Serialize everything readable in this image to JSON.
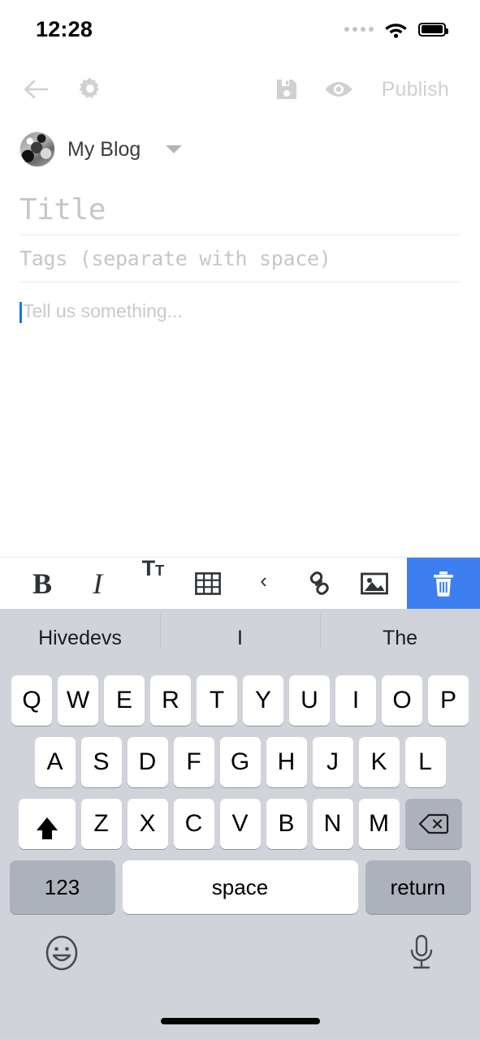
{
  "status_bar": {
    "time": "12:28",
    "signal_icon": "signal-dots-icon",
    "wifi_icon": "wifi-icon",
    "battery_icon": "battery-full-icon"
  },
  "top_toolbar": {
    "back_icon": "back-arrow-icon",
    "settings_icon": "gear-icon",
    "save_icon": "save-disk-icon",
    "preview_icon": "eye-icon",
    "publish_label": "Publish",
    "disabled_color": "#cfd0d2"
  },
  "blog_selector": {
    "avatar_icon": "avatar",
    "name": "My Blog",
    "dropdown_icon": "chevron-down-icon"
  },
  "editor": {
    "title_placeholder": "Title",
    "tags_placeholder": "Tags (separate with space)",
    "body_placeholder": "Tell us something...",
    "cursor_color": "#1a73e8"
  },
  "format_toolbar": {
    "accent_color": "#3d7ff0",
    "buttons": [
      {
        "name": "bold-button",
        "label": "B"
      },
      {
        "name": "italic-button",
        "label": "I"
      },
      {
        "name": "text-size-button",
        "label_big": "T",
        "label_small": "T"
      },
      {
        "name": "table-button",
        "label": "table-icon"
      },
      {
        "name": "quote-button",
        "label": "‹"
      },
      {
        "name": "link-button",
        "label": "link-icon"
      },
      {
        "name": "image-button",
        "label": "image-icon"
      },
      {
        "name": "delete-button",
        "label": "trash-icon"
      }
    ]
  },
  "keyboard": {
    "suggestions": [
      "Hivedevs",
      "I",
      "The"
    ],
    "row1": [
      "Q",
      "W",
      "E",
      "R",
      "T",
      "Y",
      "U",
      "I",
      "O",
      "P"
    ],
    "row2": [
      "A",
      "S",
      "D",
      "F",
      "G",
      "H",
      "J",
      "K",
      "L"
    ],
    "row3": [
      "Z",
      "X",
      "C",
      "V",
      "B",
      "N",
      "M"
    ],
    "shift_icon": "shift-arrow-icon",
    "backspace_icon": "backspace-icon",
    "numbers_key": "123",
    "space_key": "space",
    "return_key": "return",
    "emoji_icon": "emoji-smiley-icon",
    "mic_icon": "microphone-icon",
    "bg_color": "#d1d3da",
    "key_color": "#ffffff",
    "modifier_key_color": "#adb1bb"
  }
}
